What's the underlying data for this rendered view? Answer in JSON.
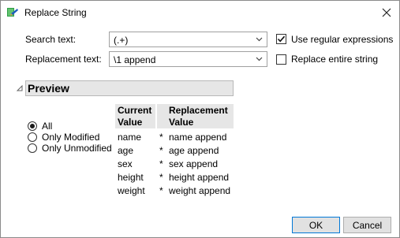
{
  "window": {
    "title": "Replace String"
  },
  "form": {
    "search_label": "Search text:",
    "search_value": "(.+)",
    "replacement_label": "Replacement text:",
    "replacement_value": "\\1 append",
    "use_regex_label": "Use regular expressions",
    "use_regex_checked": true,
    "replace_entire_label": "Replace entire string",
    "replace_entire_checked": false
  },
  "preview": {
    "title": "Preview",
    "options": [
      {
        "label": "All",
        "selected": true
      },
      {
        "label": "Only Modified",
        "selected": false
      },
      {
        "label": "Only Unmodified",
        "selected": false
      }
    ],
    "columns": [
      {
        "line1": "Current",
        "line2": "Value"
      },
      {
        "line1": "Replacement",
        "line2": "Value"
      }
    ],
    "rows": [
      {
        "current": "name",
        "marker": "*",
        "replacement": "name append"
      },
      {
        "current": "age",
        "marker": "*",
        "replacement": "age append"
      },
      {
        "current": "sex",
        "marker": "*",
        "replacement": "sex append"
      },
      {
        "current": "height",
        "marker": "*",
        "replacement": "height append"
      },
      {
        "current": "weight",
        "marker": "*",
        "replacement": "weight append"
      }
    ]
  },
  "buttons": {
    "ok": "OK",
    "cancel": "Cancel"
  },
  "icons": {
    "app": "replace-string-app-icon",
    "close": "close-icon",
    "dropdown": "chevron-down-icon",
    "disclosure": "disclosure-triangle-icon"
  }
}
